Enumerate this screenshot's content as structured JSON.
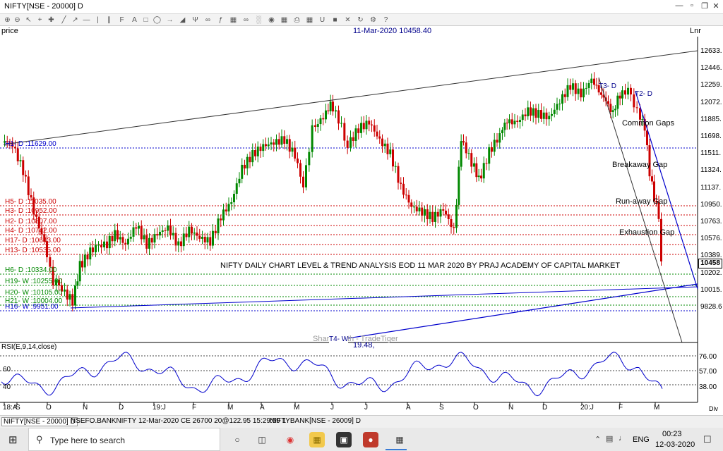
{
  "window": {
    "title": "NIFTY[NSE - 20000] D",
    "min_icon": "minimize-icon",
    "max_icon": "maximize-icon",
    "close_icon": "close-icon"
  },
  "header": {
    "price_label": "price",
    "crosshair_info": "11-Mar-2020 10458.40",
    "scale_label": "Lnr"
  },
  "chart_data": {
    "type": "candlestick",
    "title": "NIFTY DAILY CHART LEVEL & TREND ANALYSIS EOD 11 MAR 2020 BY PRAJ ACADEMY OF CAPITAL MARKET",
    "y_ticks": [
      "12633.",
      "12446.",
      "12259.",
      "12072.",
      "11885.",
      "11698.",
      "11511.",
      "11324.",
      "11137.",
      "10950.",
      "10763.",
      "10576.",
      "10389.",
      "10202.",
      "10015.",
      "9828.6"
    ],
    "last_price": "10458",
    "x_ticks": [
      "18:A",
      "S",
      "O",
      "N",
      "D",
      "19:J",
      "F",
      "M",
      "A",
      "M",
      "J",
      "J",
      "A",
      "S",
      "O",
      "N",
      "D",
      "20:J",
      "F",
      "M"
    ],
    "levels": [
      {
        "label": "H1- D :11629.00",
        "color": "#0000cc"
      },
      {
        "label": "H5- D :11035.00",
        "color": "#cc0000"
      },
      {
        "label": "H3- D :10952.00",
        "color": "#cc0000"
      },
      {
        "label": "H2- D :10807.00",
        "color": "#cc0000"
      },
      {
        "label": "H4- D :10742.00",
        "color": "#cc0000"
      },
      {
        "label": "H17- D :10643.00",
        "color": "#cc0000"
      },
      {
        "label": "H13- D :10535.00",
        "color": "#cc0000"
      },
      {
        "label": "H6- D :10334.00",
        "color": "#008800"
      },
      {
        "label": "H19- W :10255.00",
        "color": "#008800"
      },
      {
        "label": "H20- W :10105.00",
        "color": "#008800"
      },
      {
        "label": "H21- W :10004.00",
        "color": "#008800"
      },
      {
        "label": "H16- W :9951.00",
        "color": "#0000cc"
      }
    ],
    "annotations": {
      "common_gaps": "Common Gaps",
      "breakaway_gap": "Breakaway Gap",
      "runaway_gap": "Run-away Gap",
      "exhaustion_gap": "Exhaustion Gap",
      "t3": "T3- D",
      "t2": "T2- D",
      "t4": "T4- W",
      "t4_value": "19.48,",
      "watermark": "Shared with - TradeTiger"
    },
    "rsi": {
      "label": "RSI(E,9,14,close)",
      "left_ticks": [
        "60",
        "40"
      ],
      "right_ticks": [
        "76.00",
        "57.00",
        "38.00"
      ],
      "div_label": "Div"
    }
  },
  "bottom_tabs": [
    {
      "label": "NIFTY[NSE - 20000] D"
    },
    {
      "label": "NSEFO.BANKNIFTY 12-Mar-2020 CE 26700 20@122.95 15:29:59 1"
    },
    {
      "label": "NIFTYBANK[NSE - 26009] D"
    }
  ],
  "taskbar": {
    "search_placeholder": "Type here to search",
    "language": "ENG",
    "time": "00:23",
    "date": "12-03-2020"
  },
  "colors": {
    "bull": "#008800",
    "bear": "#cc0000",
    "trend_blue": "#0000cc"
  }
}
